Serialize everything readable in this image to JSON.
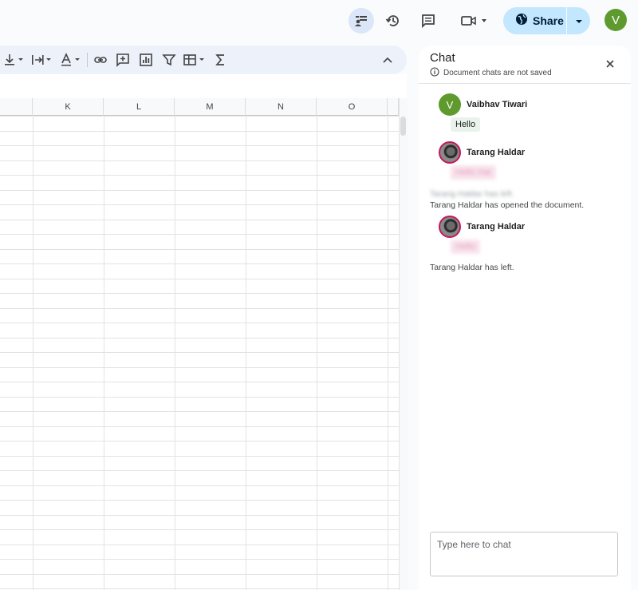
{
  "topbar": {
    "share_label": "Share",
    "avatar_letter": "V",
    "icons": [
      "chat-toggle-icon",
      "history-icon",
      "comment-icon",
      "video-call-icon",
      "globe-icon",
      "caret-down-icon"
    ]
  },
  "toolbar": {
    "icons": [
      "vertical-align-icon",
      "text-wrap-icon",
      "text-rotate-icon",
      "link-icon",
      "insert-comment-icon",
      "insert-chart-icon",
      "filter-icon",
      "filter-views-icon",
      "functions-icon",
      "collapse-icon"
    ]
  },
  "grid": {
    "columns": [
      "K",
      "L",
      "M",
      "N",
      "O"
    ]
  },
  "chat": {
    "title": "Chat",
    "subtitle": "Document chats are not saved",
    "messages": [
      {
        "name": "Vaibhav Tiwari",
        "avatar_letter": "V",
        "text": "Hello"
      },
      {
        "name": "Tarang Haldar",
        "text": "Hello Hai"
      },
      {
        "name": "Tarang Haldar",
        "text": "Hello"
      }
    ],
    "system": [
      "Tarang Haldar has left.",
      "Tarang Haldar has opened the document.",
      "Tarang Haldar has left."
    ],
    "input_placeholder": "Type here to chat"
  },
  "colors": {
    "share_bg": "#c2e7ff",
    "avatar_green": "#5e9a2e",
    "toolbar_bg": "#edf2fa"
  }
}
